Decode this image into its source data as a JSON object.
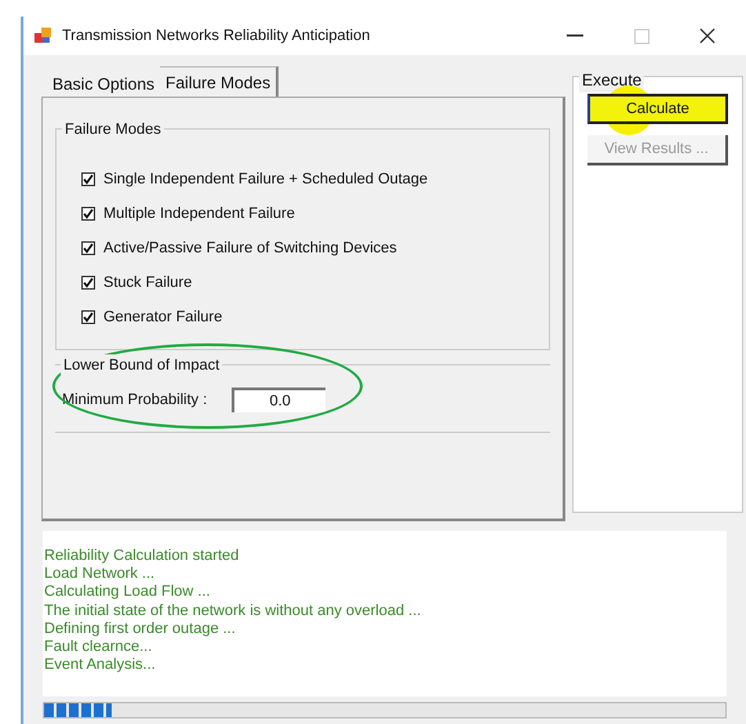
{
  "window": {
    "title": "Transmission Networks Reliability Anticipation"
  },
  "tabs": [
    {
      "label": "Basic Options",
      "selected": false
    },
    {
      "label": "Failure Modes",
      "selected": true
    }
  ],
  "failure_modes": {
    "title": "Failure Modes",
    "items": [
      {
        "label": "Single Independent Failure + Scheduled Outage",
        "checked": true
      },
      {
        "label": "Multiple Independent Failure",
        "checked": true
      },
      {
        "label": "Active/Passive Failure of Switching Devices",
        "checked": true
      },
      {
        "label": "Stuck Failure",
        "checked": true
      },
      {
        "label": "Generator Failure",
        "checked": true
      }
    ]
  },
  "lower_bound": {
    "title": "Lower Bound of Impact",
    "label": "Minimum Probability :",
    "value": "0.0"
  },
  "execute": {
    "title": "Execute",
    "buttons": [
      {
        "label": "Calculate",
        "disabled": false
      },
      {
        "label": "View Results ...",
        "disabled": true
      }
    ]
  },
  "log": [
    "Reliability Calculation started",
    "Load Network ...",
    "Calculating Load Flow ...",
    "The initial state of the network is without any overload ...",
    "Defining first order outage ...",
    "Fault clearnce...",
    "Event Analysis..."
  ],
  "progress": {
    "level": 0.1
  }
}
